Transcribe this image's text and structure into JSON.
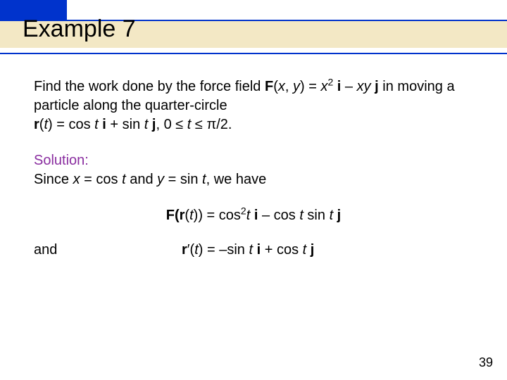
{
  "title": "Example 7",
  "problem": {
    "line1_pre": "Find the work done by the force field ",
    "F_sym": "F",
    "F_args": "(x, y) = ",
    "F_expr_x2": "x",
    "F_expr_sup": "2",
    "F_expr_i": " i",
    "F_expr_mid": " – ",
    "F_expr_xy": "xy",
    "F_expr_j": " j",
    "line1_post": " in moving a particle along the quarter-circle",
    "r_sym": "r",
    "r_args": "(t) = cos ",
    "r_t1": "t",
    "r_i": " i",
    "r_plus": " + sin ",
    "r_t2": "t",
    "r_j": " j",
    "domain": ", 0 ≤ t ≤ π/2."
  },
  "solution": {
    "label": "Solution:",
    "since_pre": "Since ",
    "since_x": "x",
    "since_eqcos": " = cos ",
    "since_t1": "t",
    "since_and": " and ",
    "since_y": "y",
    "since_eqsin": " = sin ",
    "since_t2": "t",
    "since_post": ", we have",
    "Fr_F": "F",
    "Fr_open": "(",
    "Fr_r": "r",
    "Fr_args": "(t)) = cos",
    "Fr_sup": "2",
    "Fr_t": "t",
    "Fr_i": " i",
    "Fr_mid": " – cos ",
    "Fr_t2": "t",
    "Fr_sin": " sin ",
    "Fr_t3": "t",
    "Fr_j": " j",
    "and": "and",
    "rp_r": "r",
    "rp_prime": "′",
    "rp_args": "(t) = –sin ",
    "rp_t1": "t",
    "rp_i": " i",
    "rp_plus": " + cos ",
    "rp_t2": "t",
    "rp_j": " j"
  },
  "page_number": "39"
}
